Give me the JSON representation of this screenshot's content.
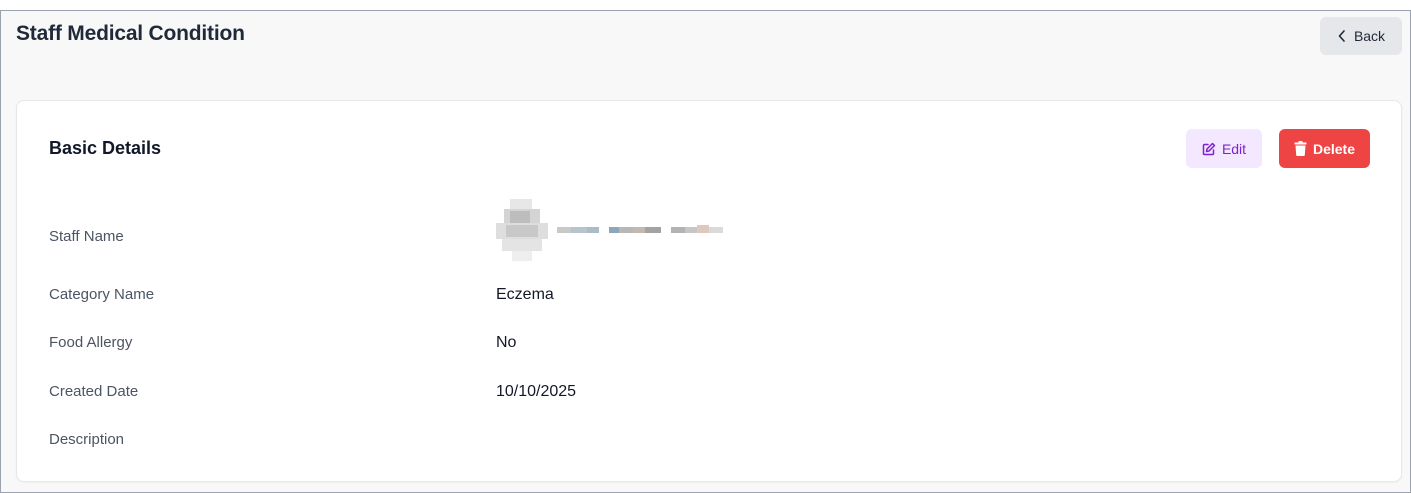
{
  "header": {
    "title": "Staff Medical Condition",
    "back_label": "Back"
  },
  "card": {
    "section_title": "Basic Details",
    "edit_label": "Edit",
    "delete_label": "Delete"
  },
  "details": {
    "staff_name_label": "Staff Name",
    "category_name_label": "Category Name",
    "category_name_value": "Eczema",
    "food_allergy_label": "Food Allergy",
    "food_allergy_value": "No",
    "created_date_label": "Created Date",
    "created_date_value": "10/10/2025",
    "description_label": "Description",
    "description_value": ""
  },
  "icons": {
    "back": "chevron-left-icon",
    "edit": "pencil-square-icon",
    "delete": "trash-icon"
  },
  "colors": {
    "edit_bg": "#f3e8ff",
    "edit_text": "#7e22ce",
    "delete_bg": "#ef4444",
    "back_bg": "#e5e7eb"
  }
}
